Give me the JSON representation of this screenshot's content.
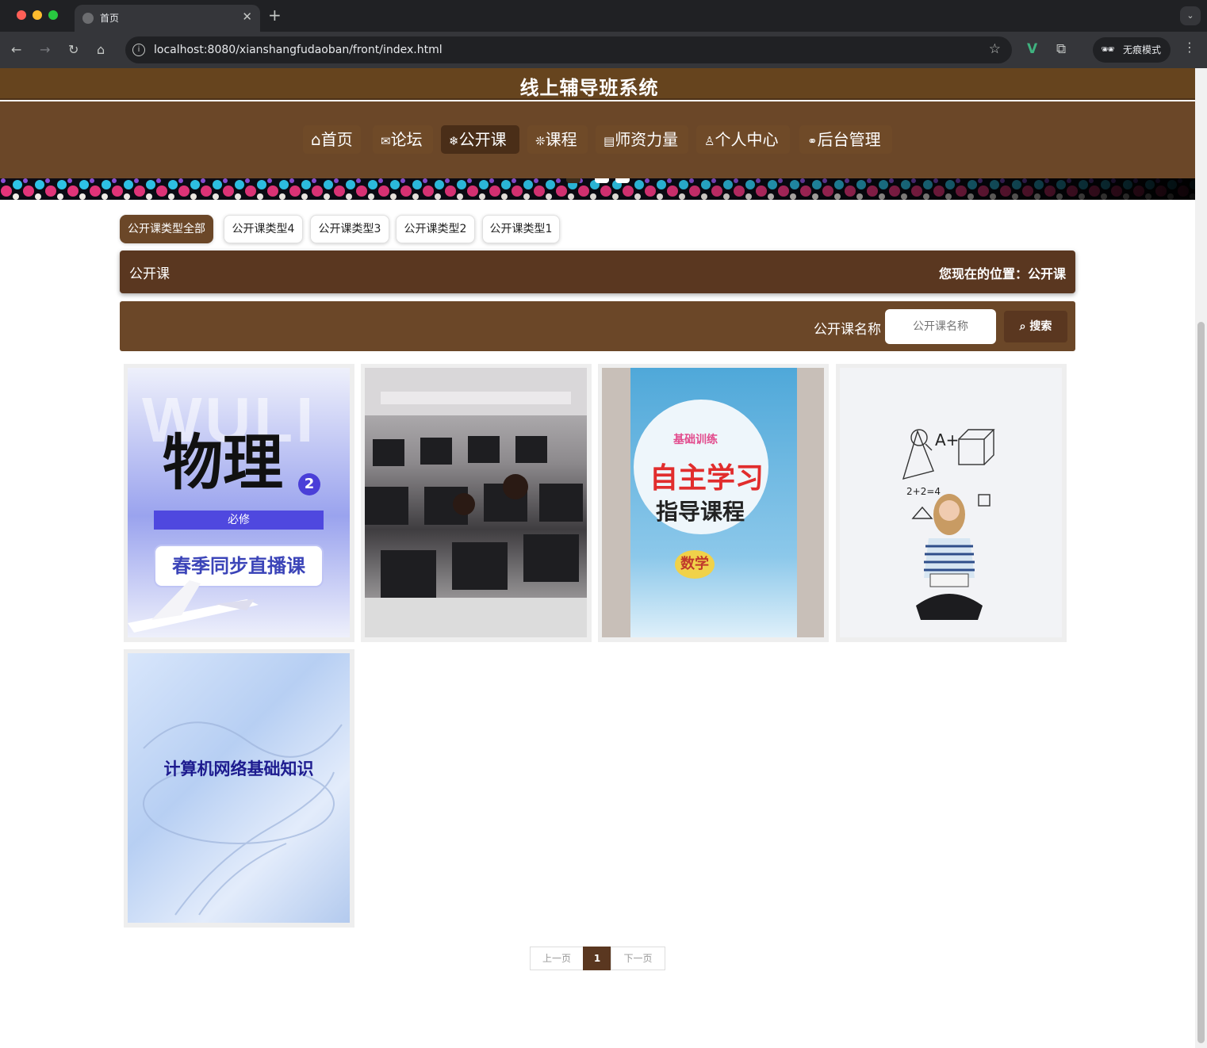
{
  "browser": {
    "tab_title": "首页",
    "url": "localhost:8080/xianshangfudaoban/front/index.html",
    "incognito_label": "无痕模式"
  },
  "site": {
    "system_name": "线上辅导班系统",
    "nav": [
      {
        "icon": "home-icon",
        "glyph": "⌂",
        "label": "首页",
        "active": false
      },
      {
        "icon": "mail-icon",
        "glyph": "✉",
        "label": "论坛",
        "active": false
      },
      {
        "icon": "snowflake-icon",
        "glyph": "❄",
        "label": "公开课",
        "active": true
      },
      {
        "icon": "loading-icon",
        "glyph": "❊",
        "label": "课程",
        "active": false
      },
      {
        "icon": "board-icon",
        "glyph": "▤",
        "label": "师资力量",
        "active": false
      },
      {
        "icon": "user-icon",
        "glyph": "♙",
        "label": "个人中心",
        "active": false
      },
      {
        "icon": "link-icon",
        "glyph": "⚭",
        "label": "后台管理",
        "active": false
      }
    ]
  },
  "types": [
    "公开课类型全部",
    "公开课类型4",
    "公开课类型3",
    "公开课类型2",
    "公开课类型1"
  ],
  "breadcrumb": {
    "title": "公开课",
    "location": "您现在的位置：公开课"
  },
  "search": {
    "label": "公开课名称",
    "placeholder": "公开课名称",
    "button": "搜索"
  },
  "courses": [
    {
      "name": "physics-cover",
      "title": "物理",
      "badge": "2",
      "tag": "必修",
      "subtitle": "春季同步直播课",
      "bg_letters": "WULI"
    },
    {
      "name": "computer-lab-photo"
    },
    {
      "name": "math-book-cover",
      "series": "基础训练",
      "title": "自主学习",
      "subtitle": "指导课程",
      "subject": "数学"
    },
    {
      "name": "girl-reading-photo",
      "formula": "A+"
    },
    {
      "name": "network-cover",
      "title": "计算机网络基础知识"
    }
  ],
  "pagination": {
    "prev": "上一页",
    "current": "1",
    "next": "下一页"
  },
  "colors": {
    "primary": "#6b4728",
    "dark": "#5a3720"
  }
}
